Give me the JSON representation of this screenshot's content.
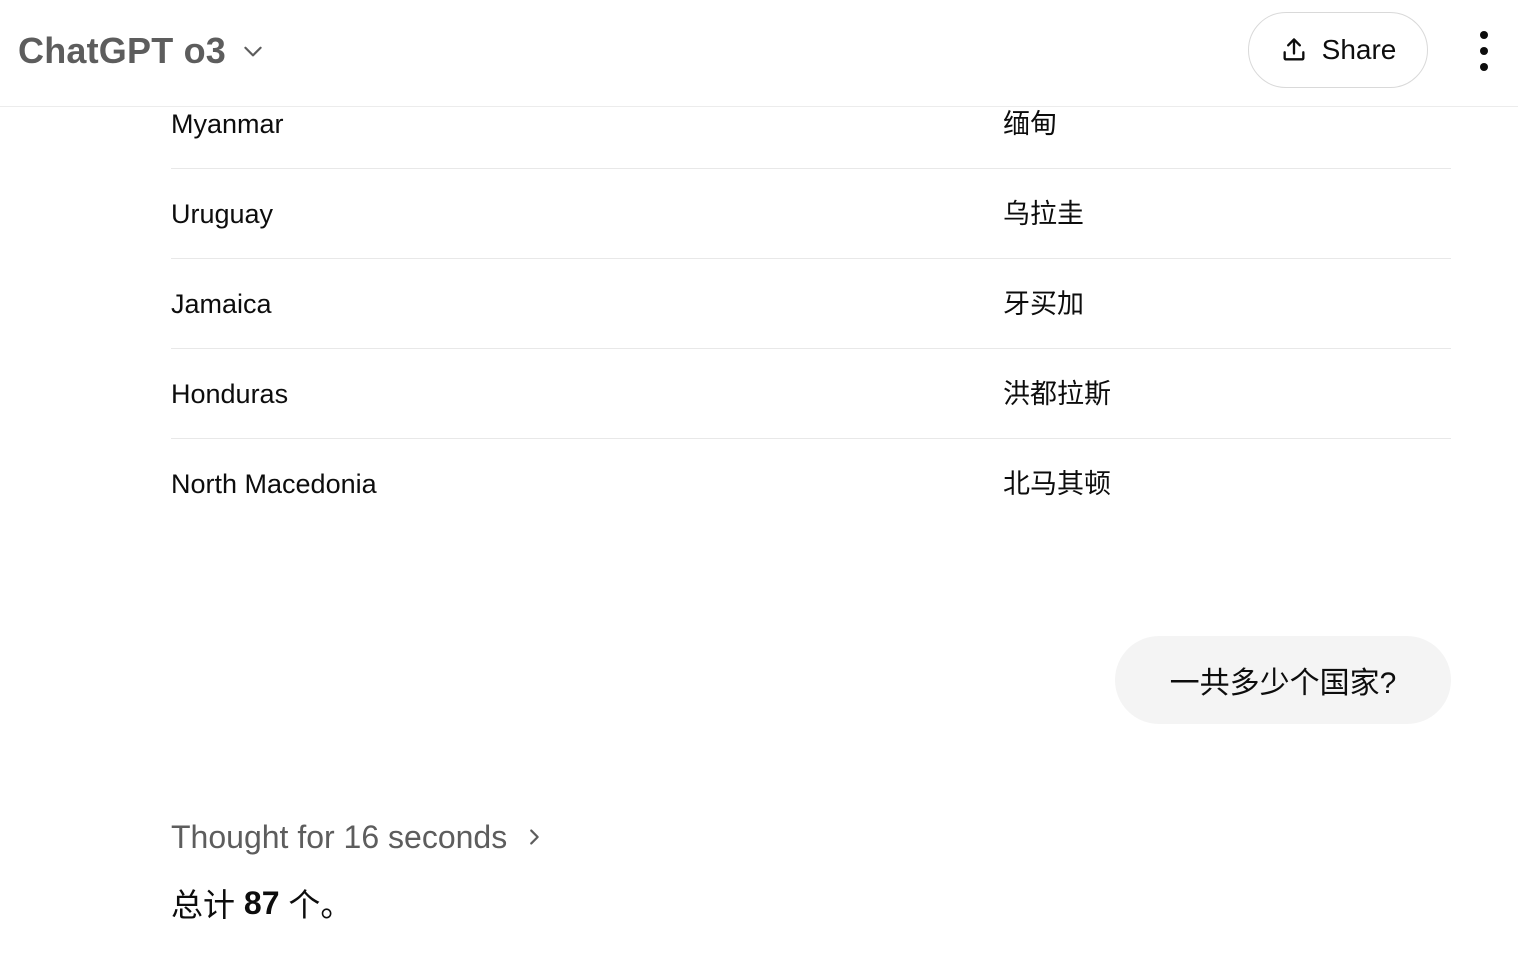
{
  "header": {
    "model_name": "ChatGPT o3",
    "share_label": "Share"
  },
  "table": {
    "rows": [
      {
        "en": "Myanmar",
        "zh": "缅甸"
      },
      {
        "en": "Uruguay",
        "zh": "乌拉圭"
      },
      {
        "en": "Jamaica",
        "zh": "牙买加"
      },
      {
        "en": "Honduras",
        "zh": "洪都拉斯"
      },
      {
        "en": "North Macedonia",
        "zh": "北马其顿"
      }
    ]
  },
  "user_message": "一共多少个国家?",
  "assistant": {
    "thought_label": "Thought for 16 seconds",
    "answer_prefix": "总计 ",
    "answer_count": "87",
    "answer_suffix": " 个。"
  },
  "colors": {
    "muted_text": "#5d5d5d",
    "bubble_bg": "#f4f4f4",
    "divider": "#e8e8e8"
  }
}
